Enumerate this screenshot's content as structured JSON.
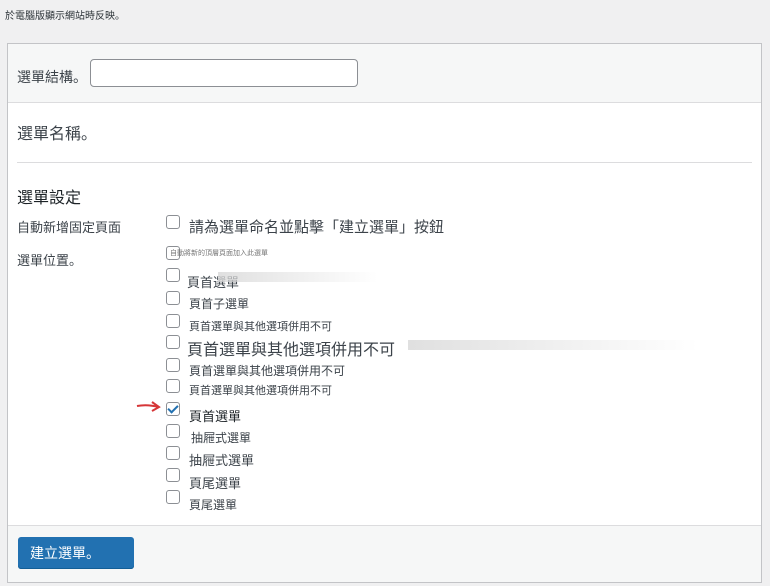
{
  "top_note": "於電腦版顯示網站時反映。",
  "structure": {
    "label": "選單結構。",
    "input_value": "",
    "input_placeholder": ""
  },
  "menu_name": {
    "label": "選單名稱。"
  },
  "settings": {
    "title": "選單設定",
    "auto_add_label": "自動新增固定頁面",
    "auto_add_text": "請為選單命名並點擊「建立選單」按鈕",
    "locations_label": "選單位置。",
    "locations": [
      {
        "text": "自動將新的頂層頁面加入此選單",
        "checked": false
      },
      {
        "text": "頁首選單",
        "checked": false
      },
      {
        "text": "頁首子選單",
        "checked": false
      },
      {
        "text": "頁首選單與其他選項併用不可",
        "checked": false
      },
      {
        "text": "頁首選單與其他選項併用不可",
        "checked": false
      },
      {
        "text": "頁首選單與其他選項併用不可",
        "checked": false
      },
      {
        "text": "頁首選單與其他選項併用不可",
        "checked": false
      },
      {
        "text": "頁首選單",
        "checked": true
      },
      {
        "text": "抽屜式選單",
        "checked": false
      },
      {
        "text": "抽屜式選單",
        "checked": false
      },
      {
        "text": "頁尾選單",
        "checked": false
      },
      {
        "text": "頁尾選單",
        "checked": false
      }
    ]
  },
  "footer": {
    "create_button": "建立選單。"
  },
  "colors": {
    "accent": "#2271b1",
    "arrow": "#d63638"
  }
}
